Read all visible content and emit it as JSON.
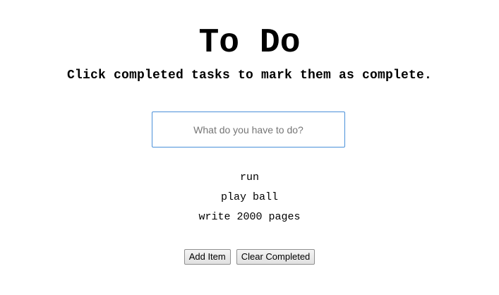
{
  "header": {
    "title": "To Do",
    "subtitle": "Click completed tasks to mark them as complete."
  },
  "input": {
    "placeholder": "What do you have to do?",
    "value": ""
  },
  "tasks": [
    {
      "label": "run"
    },
    {
      "label": "play ball"
    },
    {
      "label": "write 2000 pages"
    }
  ],
  "buttons": {
    "add_label": "Add Item",
    "clear_label": "Clear Completed"
  },
  "colors": {
    "input_border": "#4a90d9",
    "text": "#000000",
    "placeholder": "#757575",
    "background": "#ffffff"
  }
}
